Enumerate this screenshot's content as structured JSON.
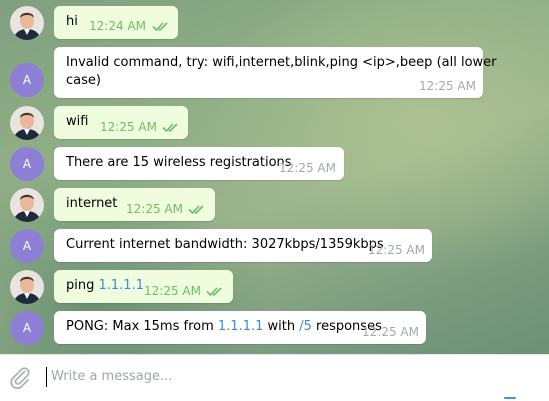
{
  "messages": [
    {
      "dir": "out",
      "text": "hi",
      "time": "12:24 AM"
    },
    {
      "dir": "in",
      "avatar": "A",
      "line1": "Invalid command, try: wifi,internet,blink,ping <ip>,beep (all lower",
      "line2": "case)",
      "time": "12:25 AM"
    },
    {
      "dir": "out",
      "text": "wifi",
      "time": "12:25 AM"
    },
    {
      "dir": "in",
      "avatar": "A",
      "text": "There are 15 wireless registrations",
      "time": "12:25 AM"
    },
    {
      "dir": "out",
      "text": "internet",
      "time": "12:25 AM"
    },
    {
      "dir": "in",
      "avatar": "A",
      "text": "Current internet bandwidth: 3027kbps/1359kbps",
      "time": "12:25 AM"
    },
    {
      "dir": "out",
      "prefix": "ping ",
      "ip": "1.1.1.1",
      "time": "12:25 AM"
    },
    {
      "dir": "in",
      "avatar": "A",
      "pre": "PONG: Max 15ms from ",
      "ip": "1.1.1.1",
      "mid": " with ",
      "cmd": "/5",
      "post": " responses",
      "time": "12:25 AM"
    }
  ],
  "compose": {
    "placeholder": "Write a message..."
  },
  "colors": {
    "accent": "#3a8bd8",
    "outgoing_bubble": "#effdde",
    "avatar": "#8e7fd6",
    "check": "#6cbf62"
  },
  "icons": {
    "attach": "paperclip-icon",
    "read": "double-check-icon"
  }
}
